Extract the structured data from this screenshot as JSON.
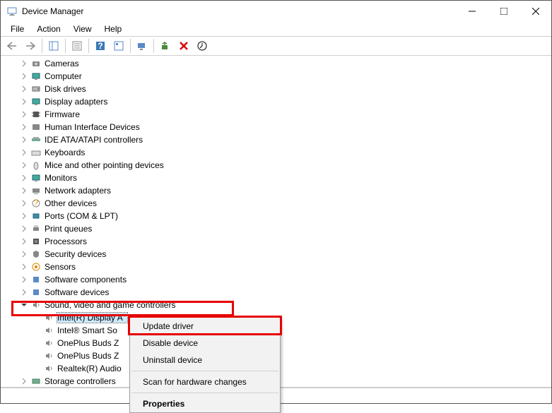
{
  "window": {
    "title": "Device Manager"
  },
  "menu": {
    "file": "File",
    "action": "Action",
    "view": "View",
    "help": "Help"
  },
  "categories": [
    {
      "name": "Cameras",
      "icon": "camera"
    },
    {
      "name": "Computer",
      "icon": "monitor"
    },
    {
      "name": "Disk drives",
      "icon": "disk"
    },
    {
      "name": "Display adapters",
      "icon": "monitor"
    },
    {
      "name": "Firmware",
      "icon": "chip"
    },
    {
      "name": "Human Interface Devices",
      "icon": "hid"
    },
    {
      "name": "IDE ATA/ATAPI controllers",
      "icon": "ide"
    },
    {
      "name": "Keyboards",
      "icon": "keyboard"
    },
    {
      "name": "Mice and other pointing devices",
      "icon": "mouse"
    },
    {
      "name": "Monitors",
      "icon": "monitor"
    },
    {
      "name": "Network adapters",
      "icon": "net"
    },
    {
      "name": "Other devices",
      "icon": "other"
    },
    {
      "name": "Ports (COM & LPT)",
      "icon": "port"
    },
    {
      "name": "Print queues",
      "icon": "printer"
    },
    {
      "name": "Processors",
      "icon": "cpu"
    },
    {
      "name": "Security devices",
      "icon": "security"
    },
    {
      "name": "Sensors",
      "icon": "sensor"
    },
    {
      "name": "Software components",
      "icon": "sw"
    },
    {
      "name": "Software devices",
      "icon": "sw"
    }
  ],
  "sound_category": {
    "name": "Sound, video and game controllers",
    "children": [
      "Intel(R) Display A",
      "Intel® Smart So",
      "OnePlus Buds Z",
      "OnePlus Buds Z",
      "Realtek(R) Audio"
    ]
  },
  "storage_category": "Storage controllers",
  "context_menu": {
    "update": "Update driver",
    "disable": "Disable device",
    "uninstall": "Uninstall device",
    "scan": "Scan for hardware changes",
    "properties": "Properties"
  }
}
